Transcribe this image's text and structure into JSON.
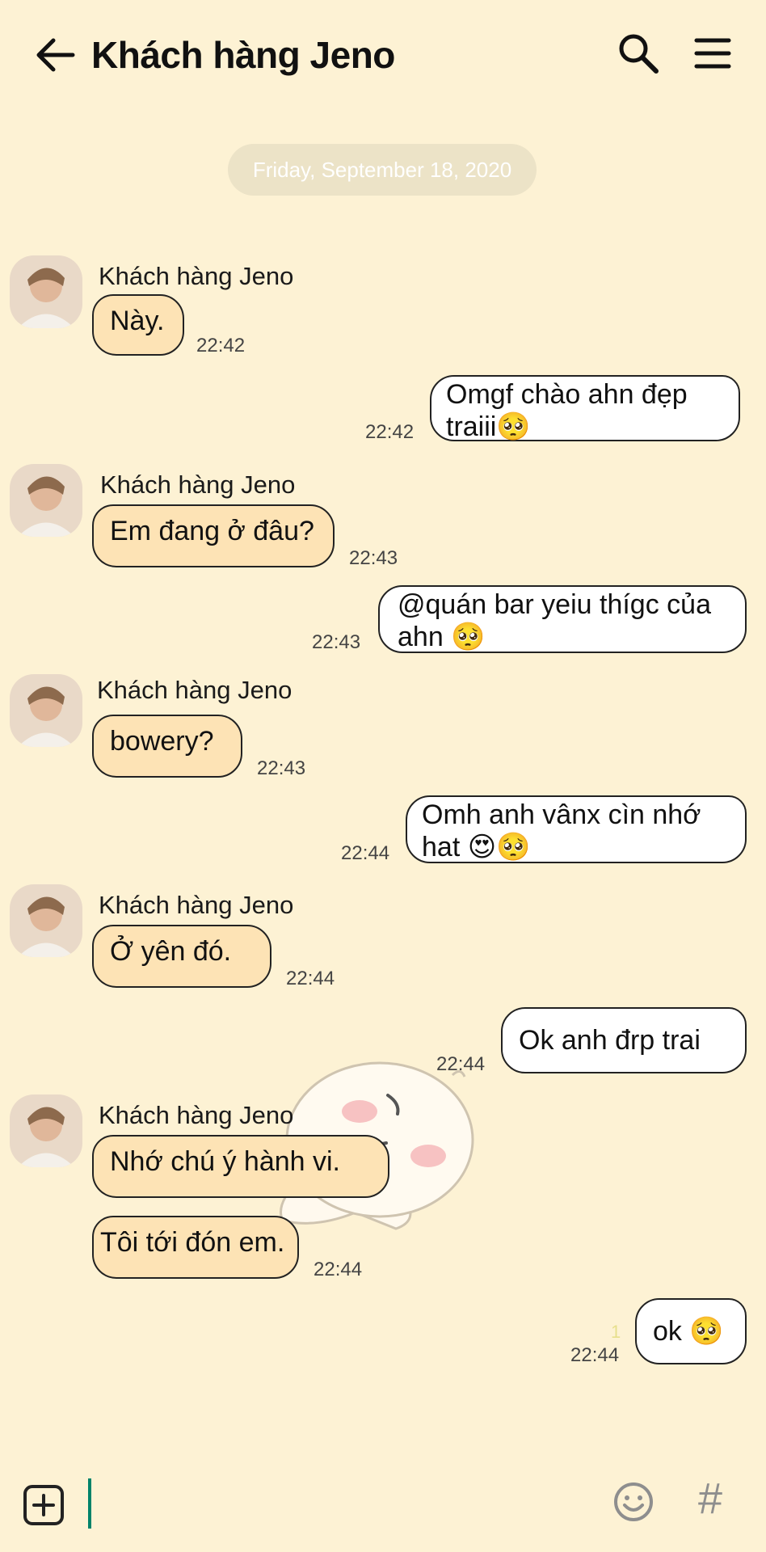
{
  "header": {
    "title": "Khách hàng Jeno"
  },
  "date_separator": "Friday, September 18, 2020",
  "contact_name": "Khách hàng Jeno",
  "messages": [
    {
      "sender": "in",
      "text": "Này.",
      "time": "22:42"
    },
    {
      "sender": "out",
      "text": "Omgf chào ahn đẹp traiii🥺",
      "time": "22:42"
    },
    {
      "sender": "in",
      "text": "Em đang ở đâu?",
      "time": "22:43"
    },
    {
      "sender": "out",
      "text": "@quán bar yeiu thígc của ahn 🥺",
      "time": "22:43"
    },
    {
      "sender": "in",
      "text": "bowery?",
      "time": "22:43"
    },
    {
      "sender": "out",
      "text": "Omh anh vânx cìn nhớ hat 😍🥺",
      "time": "22:44"
    },
    {
      "sender": "in",
      "text": "Ở yên đó.",
      "time": "22:44"
    },
    {
      "sender": "out",
      "text": "Ok anh đrp trai",
      "time": "22:44"
    },
    {
      "sender": "in",
      "text": "Nhớ chú ý hành vi.",
      "time": ""
    },
    {
      "sender": "in",
      "text": "Tôi tới đón em.",
      "time": "22:44"
    },
    {
      "sender": "out",
      "text": "ok 🥺",
      "time": "22:44",
      "read_count": "1"
    }
  ],
  "colors": {
    "background": "#fdf2d4",
    "incoming_bubble": "#fde3b5",
    "outgoing_bubble": "#ffffff",
    "cursor": "#00836a"
  },
  "icons": [
    "back-arrow-icon",
    "search-icon",
    "menu-icon",
    "plus-square-icon",
    "emoji-icon",
    "hashtag-icon"
  ]
}
